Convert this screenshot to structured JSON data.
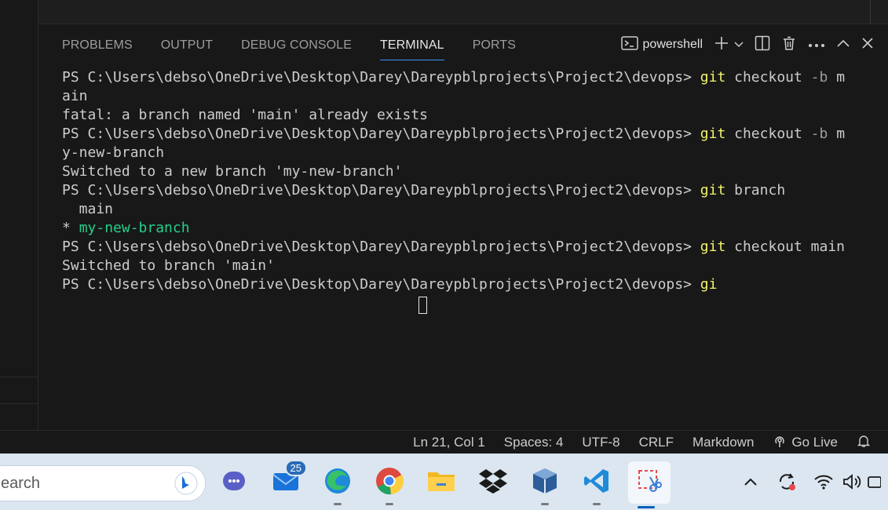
{
  "panel": {
    "tabs": [
      {
        "label": "PROBLEMS"
      },
      {
        "label": "OUTPUT"
      },
      {
        "label": "DEBUG CONSOLE"
      },
      {
        "label": "TERMINAL"
      },
      {
        "label": "PORTS"
      }
    ],
    "shell": "powershell",
    "icons": {
      "shell": "terminal-powershell-icon",
      "add": "plus-icon",
      "dropdown": "chevron-down-icon",
      "split": "split-terminal-icon",
      "kill": "trash-icon",
      "more": "ellipsis-icon",
      "maximize": "chevron-up-icon",
      "close": "close-icon"
    }
  },
  "terminal": {
    "lines": [
      {
        "prompt": "PS C:\\Users\\debso\\OneDrive\\Desktop\\Darey\\Dareypblprojects\\Project2\\devops> ",
        "cmd": "git",
        "rest": " checkout ",
        "flag": "-b",
        "tail": " m"
      },
      {
        "text": "ain"
      },
      {
        "text": "fatal: a branch named 'main' already exists"
      },
      {
        "prompt": "PS C:\\Users\\debso\\OneDrive\\Desktop\\Darey\\Dareypblprojects\\Project2\\devops> ",
        "cmd": "git",
        "rest": " checkout ",
        "flag": "-b",
        "tail": " m"
      },
      {
        "text": "y-new-branch"
      },
      {
        "text": "Switched to a new branch 'my-new-branch'"
      },
      {
        "prompt": "PS C:\\Users\\debso\\OneDrive\\Desktop\\Darey\\Dareypblprojects\\Project2\\devops> ",
        "cmd": "git",
        "rest": " branch",
        "flag": "",
        "tail": ""
      },
      {
        "text": "  main"
      },
      {
        "star": "* ",
        "green": "my-new-branch"
      },
      {
        "prompt": "PS C:\\Users\\debso\\OneDrive\\Desktop\\Darey\\Dareypblprojects\\Project2\\devops> ",
        "cmd": "git",
        "rest": " checkout main",
        "flag": "",
        "tail": ""
      },
      {
        "text": "Switched to branch 'main'"
      },
      {
        "prompt": "PS C:\\Users\\debso\\OneDrive\\Desktop\\Darey\\Dareypblprojects\\Project2\\devops> ",
        "cmd": "gi",
        "rest": "",
        "flag": "",
        "tail": ""
      }
    ]
  },
  "status": {
    "position": "Ln 21, Col 1",
    "spaces": "Spaces: 4",
    "encoding": "UTF-8",
    "eol": "CRLF",
    "language": "Markdown",
    "golive": "Go Live",
    "icons": {
      "golive": "broadcast-icon",
      "bell": "bell-icon"
    }
  },
  "taskbar": {
    "search_text": "earch",
    "mail_badge": "25",
    "icons": [
      "bing-icon",
      "teams-icon",
      "mail-icon",
      "edge-icon",
      "chrome-icon",
      "file-explorer-icon",
      "dropbox-icon",
      "virtualbox-icon",
      "vscode-icon",
      "snipping-tool-icon"
    ],
    "tray_icons": [
      "chevron-up-icon",
      "sync-icon",
      "wifi-icon",
      "volume-icon",
      "battery-icon"
    ]
  },
  "colors": {
    "panel_bg": "#181818",
    "command": "#f1f16b",
    "flag": "#9d9d9d",
    "branch_green": "#23d18b",
    "active_tab_underline": "#3794ff",
    "taskbar_bg": "#dbe6f1"
  }
}
